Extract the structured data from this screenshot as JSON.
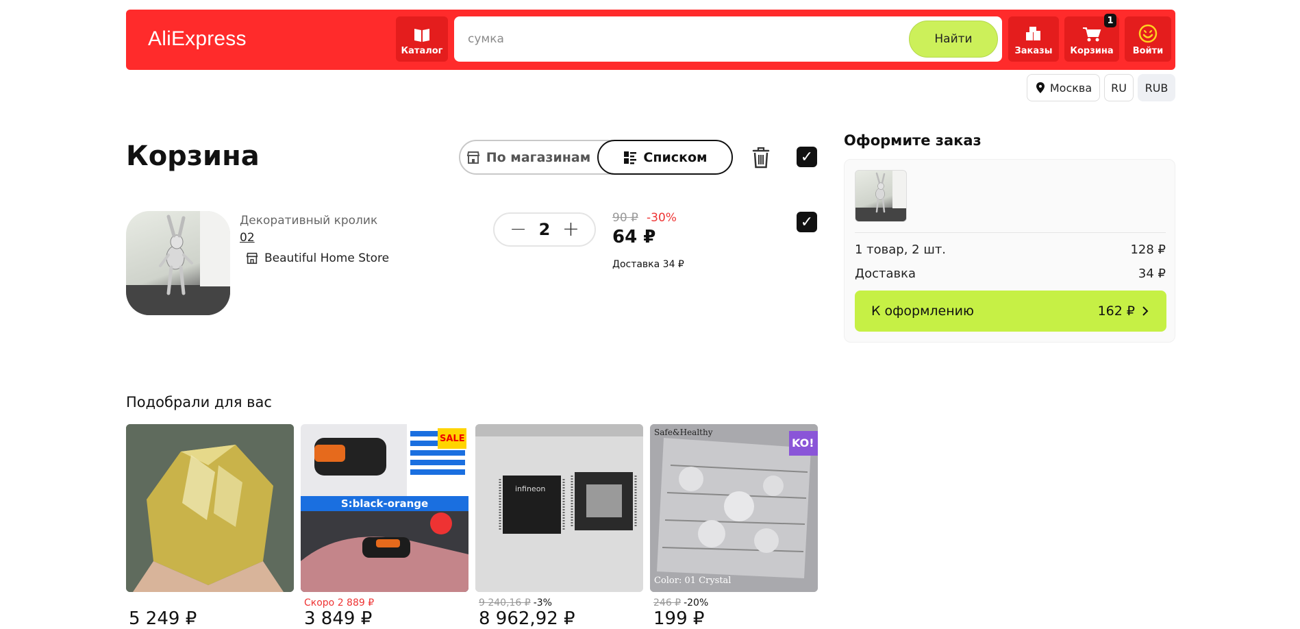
{
  "header": {
    "logo": "AliExpress",
    "catalog_label": "Каталог",
    "search_placeholder": "сумка",
    "search_button": "Найти",
    "orders_label": "Заказы",
    "cart_label": "Корзина",
    "cart_count": "1",
    "login_label": "Войти"
  },
  "subbar": {
    "city": "Москва",
    "language": "RU",
    "currency": "RUB"
  },
  "cart": {
    "title": "Корзина",
    "view_by_store": "По магазинам",
    "view_list": "Списком",
    "item": {
      "name": "Декоративный кролик",
      "variant": "02",
      "store": "Beautiful Home Store",
      "quantity": "2",
      "old_price": "90 ₽",
      "discount": "-30%",
      "price": "64 ₽",
      "delivery": "Доставка 34 ₽"
    }
  },
  "order": {
    "title": "Оформите заказ",
    "items_label": "1 товар, 2 шт.",
    "items_value": "128 ₽",
    "delivery_label": "Доставка",
    "delivery_value": "34 ₽",
    "checkout_label": "К оформлению",
    "checkout_total": "162 ₽"
  },
  "recommendations": {
    "title": "Подобрали для вас",
    "items": [
      {
        "old": "",
        "discount": "",
        "soon": "",
        "price": "5 249 ₽"
      },
      {
        "old": "",
        "discount": "",
        "soon": "Скоро 2 889 ₽",
        "price": "3 849 ₽"
      },
      {
        "old": "9 240,16 ₽",
        "discount": "-3%",
        "soon": "",
        "price": "8 962,92 ₽"
      },
      {
        "old": "246 ₽",
        "discount": "-20%",
        "soon": "",
        "price": "199 ₽"
      }
    ],
    "card2_banner": "S:black-orange",
    "card2_sale": "SALE",
    "card3_brand": "infineon",
    "card4_top_text": "Safe&Healthy",
    "card4_bottom_text": "Color: 01 Crystal",
    "card4_badge": "KO!"
  },
  "colors": {
    "brand_red": "#ff2b2b",
    "accent_lime": "#ccf05a"
  }
}
